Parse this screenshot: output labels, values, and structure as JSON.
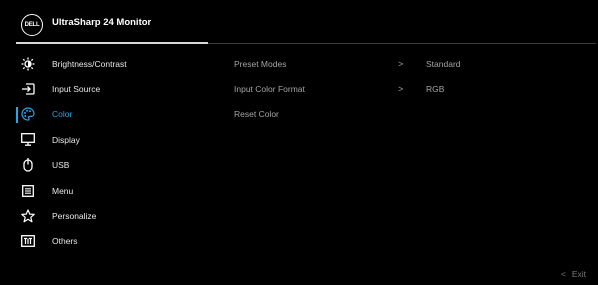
{
  "header": {
    "logo_text": "DELL",
    "title": "UltraSharp 24 Monitor"
  },
  "menu": {
    "items": [
      {
        "label": "Brightness/Contrast",
        "icon": "brightness-icon"
      },
      {
        "label": "Input Source",
        "icon": "input-source-icon"
      },
      {
        "label": "Color",
        "icon": "color-palette-icon",
        "active": true
      },
      {
        "label": "Display",
        "icon": "display-icon"
      },
      {
        "label": "USB",
        "icon": "usb-icon"
      },
      {
        "label": "Menu",
        "icon": "menu-icon"
      },
      {
        "label": "Personalize",
        "icon": "star-icon"
      },
      {
        "label": "Others",
        "icon": "others-icon"
      }
    ]
  },
  "submenu": {
    "rows": [
      {
        "label": "Preset Modes",
        "chevron": ">",
        "value": "Standard"
      },
      {
        "label": "Input Color Format",
        "chevron": ">",
        "value": "RGB"
      },
      {
        "label": "Reset Color",
        "chevron": "",
        "value": ""
      }
    ]
  },
  "footer": {
    "exit_chevron": "<",
    "exit_label": "Exit"
  },
  "colors": {
    "accent": "#2aa6e8",
    "background": "#000000",
    "inactive_text": "#a4a4a4"
  }
}
